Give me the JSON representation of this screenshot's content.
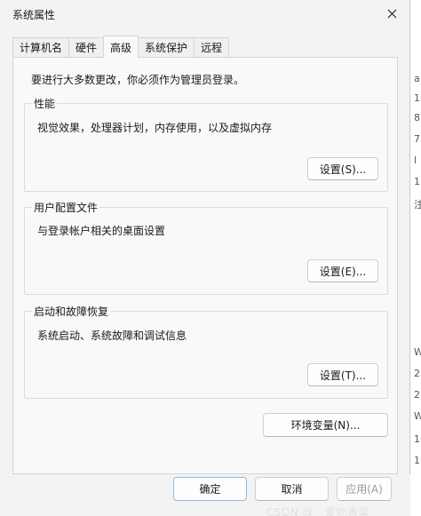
{
  "window": {
    "title": "系统属性"
  },
  "tabs": [
    {
      "label": "计算机名",
      "active": false
    },
    {
      "label": "硬件",
      "active": false
    },
    {
      "label": "高级",
      "active": true
    },
    {
      "label": "系统保护",
      "active": false
    },
    {
      "label": "远程",
      "active": false
    }
  ],
  "admin_note": "要进行大多数更改，你必须作为管理员登录。",
  "groups": {
    "performance": {
      "title": "性能",
      "description": "视觉效果，处理器计划，内存使用，以及虚拟内存",
      "button": "设置(S)..."
    },
    "user_profiles": {
      "title": "用户配置文件",
      "description": "与登录帐户相关的桌面设置",
      "button": "设置(E)..."
    },
    "startup_recovery": {
      "title": "启动和故障恢复",
      "description": "系统启动、系统故障和调试信息",
      "button": "设置(T)..."
    }
  },
  "env_button": "环境变量(N)...",
  "footer": {
    "ok": "确定",
    "cancel": "取消",
    "apply": "应用(A)"
  },
  "watermark": "CSDN @__爱吃香菜",
  "background_edge": [
    "a",
    "1",
    "8",
    "7",
    "l",
    "1",
    "注",
    "W",
    "2",
    "2",
    "W",
    "1",
    "1"
  ]
}
